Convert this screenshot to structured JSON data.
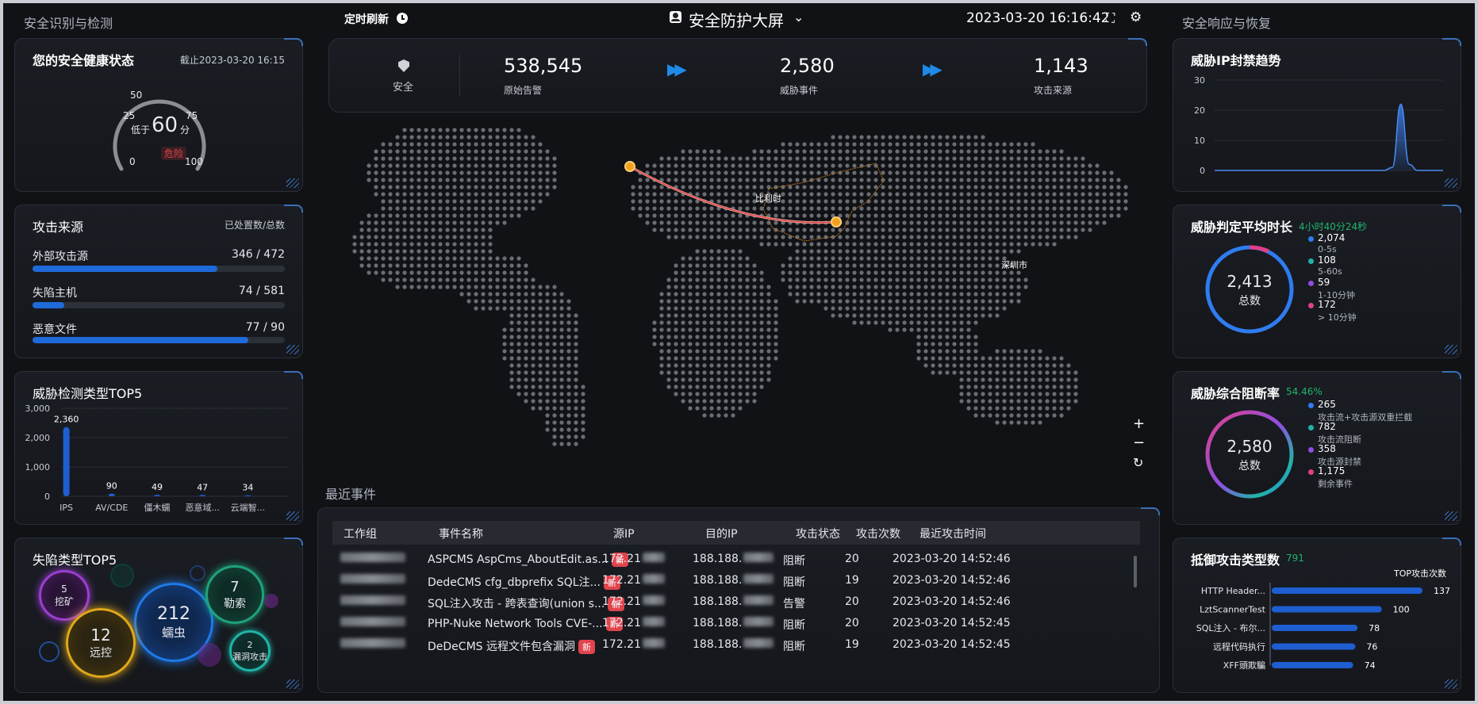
{
  "header": {
    "left_section": "安全识别与检测",
    "right_section": "安全响应与恢复",
    "refresh_label": "定时刷新",
    "title": "安全防护大屏",
    "datetime": "2023-03-20 16:16:42"
  },
  "health": {
    "title": "您的安全健康状态",
    "as_of": "截止2023-03-20 16:15",
    "gauge_ticks": [
      "0",
      "25",
      "50",
      "75",
      "100"
    ],
    "prefix": "低于",
    "score": "60",
    "unit": "分",
    "status": "危险",
    "score_value": 60
  },
  "attack_source": {
    "title": "攻击来源",
    "subtitle": "已处置数/总数",
    "items": [
      {
        "label": "外部攻击源",
        "value": "346 / 472",
        "ratio": 0.733
      },
      {
        "label": "失陷主机",
        "value": "74 / 581",
        "ratio": 0.127
      },
      {
        "label": "恶意文件",
        "value": "77 / 90",
        "ratio": 0.856
      }
    ]
  },
  "threat_top5": {
    "title": "威胁检测类型TOP5"
  },
  "fallen_top5": {
    "title": "失陷类型TOP5",
    "bubbles": [
      {
        "value": "5",
        "label": "挖矿"
      },
      {
        "value": "212",
        "label": "蠕虫"
      },
      {
        "value": "7",
        "label": "勒索"
      },
      {
        "value": "12",
        "label": "远控"
      },
      {
        "value": "2",
        "label": "漏洞攻击"
      }
    ]
  },
  "summary": {
    "safe_label": "安全",
    "stats": [
      {
        "value": "538,545",
        "label": "原始告警"
      },
      {
        "value": "2,580",
        "label": "威胁事件"
      },
      {
        "value": "1,143",
        "label": "攻击来源"
      }
    ]
  },
  "map": {
    "source_city": "比利时",
    "target_city": "深圳市",
    "zoom_in": "+",
    "zoom_out": "−",
    "reset": "↻"
  },
  "events": {
    "title": "最近事件",
    "columns": [
      "工作组",
      "事件名称",
      "源IP",
      "目的IP",
      "攻击状态",
      "攻击次数",
      "最近攻击时间"
    ],
    "new_label": "新",
    "rows": [
      {
        "name": "ASPCMS AspCms_AboutEdit.as...",
        "src": "172.21",
        "dst": "188.188.",
        "status": "阻断",
        "count": "20",
        "time": "2023-03-20 14:52:46"
      },
      {
        "name": "DedeCMS cfg_dbprefix SQL注...",
        "src": "172.21",
        "dst": "188.188.",
        "status": "阻断",
        "count": "19",
        "time": "2023-03-20 14:52:46"
      },
      {
        "name": "SQL注入攻击 - 跨表查询(union s...",
        "src": "172.21",
        "dst": "188.188.",
        "status": "告警",
        "count": "20",
        "time": "2023-03-20 14:52:46"
      },
      {
        "name": "PHP-Nuke Network Tools CVE-...",
        "src": "172.21",
        "dst": "188.188.",
        "status": "阻断",
        "count": "20",
        "time": "2023-03-20 14:52:45"
      },
      {
        "name": "DeDeCMS 远程文件包含漏洞",
        "src": "172.21",
        "dst": "188.188.",
        "status": "阻断",
        "count": "19",
        "time": "2023-03-20 14:52:45"
      }
    ]
  },
  "ip_block_trend": {
    "title": "威胁IP封禁趋势"
  },
  "judge_time": {
    "title": "威胁判定平均时长",
    "avg": "4小时40分24秒",
    "total": "2,413",
    "total_label": "总数",
    "legend": [
      {
        "value": "2,074",
        "label": "0-5s",
        "color": "#2f7cf0"
      },
      {
        "value": "108",
        "label": "5-60s",
        "color": "#1fb5a6"
      },
      {
        "value": "59",
        "label": "1-10分钟",
        "color": "#8e4fe0"
      },
      {
        "value": "172",
        "label": "> 10分钟",
        "color": "#e0408a"
      }
    ]
  },
  "block_rate": {
    "title": "威胁综合阻断率",
    "rate": "54.46%",
    "total": "2,580",
    "total_label": "总数",
    "legend": [
      {
        "value": "265",
        "label": "攻击流+攻击源双重拦截",
        "color": "#2f7cf0"
      },
      {
        "value": "782",
        "label": "攻击流阻断",
        "color": "#1fb5a6"
      },
      {
        "value": "358",
        "label": "攻击源封禁",
        "color": "#8e4fe0"
      },
      {
        "value": "1,175",
        "label": "剩余事件",
        "color": "#e0408a"
      }
    ]
  },
  "defense_types": {
    "title": "抵御攻击类型数",
    "count": "791"
  },
  "chart_data": [
    {
      "type": "bar",
      "title": "威胁检测类型TOP5",
      "categories": [
        "IPS",
        "AV/CDE",
        "僵木蠕",
        "恶意域...",
        "云端智..."
      ],
      "values": [
        2360,
        90,
        49,
        47,
        34
      ],
      "value_labels": [
        "2,360",
        "90",
        "49",
        "47",
        "34"
      ],
      "yticks": [
        "0",
        "1,000",
        "2,000",
        "3,000"
      ],
      "ylim": [
        0,
        3000
      ]
    },
    {
      "type": "area",
      "title": "威胁IP封禁趋势",
      "yticks": [
        "0",
        "10",
        "20",
        "30"
      ],
      "ylim": [
        0,
        30
      ],
      "values": [
        0,
        0,
        0,
        0,
        0,
        0,
        0,
        0,
        0,
        0,
        0,
        0,
        0,
        0,
        0,
        0,
        0,
        0,
        0,
        0,
        0,
        1,
        22,
        2,
        0,
        0,
        0,
        0
      ]
    },
    {
      "type": "bar",
      "title": "抵御攻击类型数",
      "series_label": "TOP攻击次数",
      "categories": [
        "HTTP Header...",
        "LztScannerTest",
        "SQL注入 - 布尔...",
        "远程代码执行",
        "XFF頭欺騙"
      ],
      "values": [
        137,
        100,
        78,
        76,
        74
      ],
      "value_labels": [
        "137",
        "100",
        "78",
        "76",
        "74"
      ]
    }
  ]
}
